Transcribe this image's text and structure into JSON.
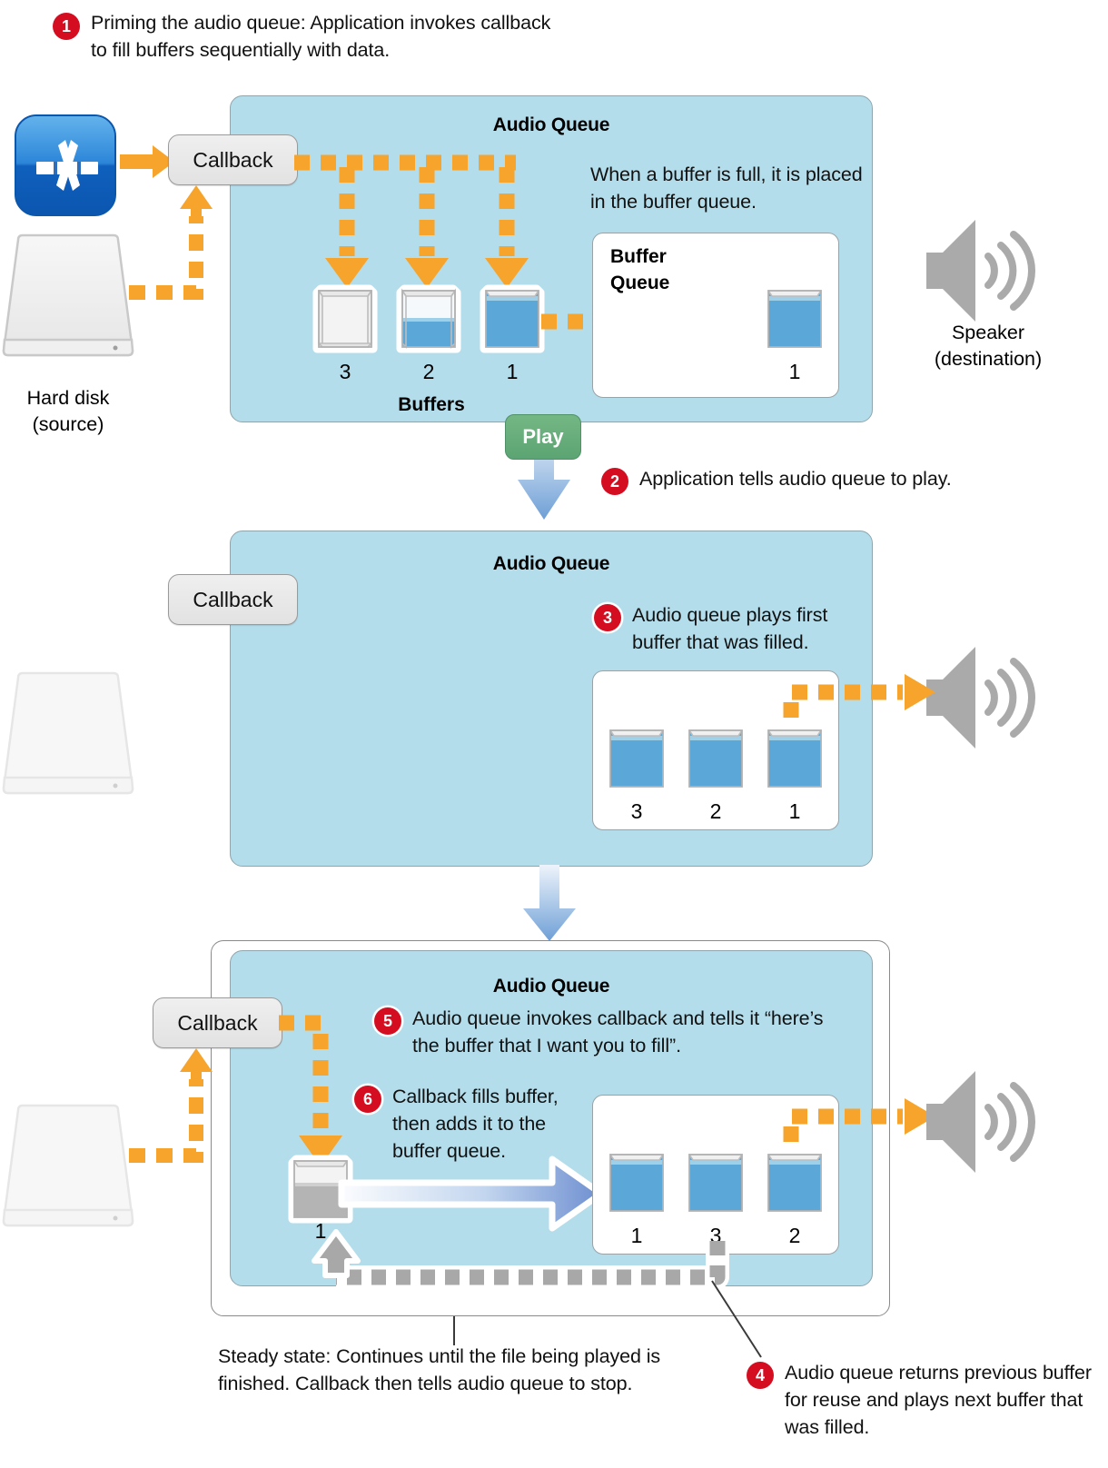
{
  "colors": {
    "panel_fill": "#b4ddeb",
    "panel_border": "#8fa6ae",
    "badge_red": "#d50d20",
    "dash_orange": "#f6a42c",
    "dash_grey": "#a8a8a8",
    "buffer_blue": "#5ba8d8",
    "play_green": "#5ca473",
    "arrow_blue": "#6e9fd6",
    "speaker_grey": "#aaaaaa"
  },
  "steps": [
    {
      "num": "1",
      "text": "Priming the audio queue: Application invokes callback to fill buffers sequentially with data."
    },
    {
      "num": "2",
      "text": "Application tells audio queue to play."
    },
    {
      "num": "3",
      "text": "Audio queue plays first buffer that was filled."
    },
    {
      "num": "4",
      "text": "Audio queue returns previous buffer for reuse and plays next buffer that was filled."
    },
    {
      "num": "5",
      "text": "Audio queue invokes callback and tells it “here’s the buffer that I want you to fill”."
    },
    {
      "num": "6",
      "text": "Callback fills buffer, then adds it to the buffer queue."
    }
  ],
  "labels": {
    "hard_disk": "Hard disk\n(source)",
    "hard_disk_line1": "Hard disk",
    "hard_disk_line2": "(source)",
    "speaker_line1": "Speaker",
    "speaker_line2": "(destination)",
    "callback": "Callback",
    "play": "Play",
    "audio_queue": "Audio Queue",
    "buffers": "Buffers",
    "buffer_queue_line1": "Buffer",
    "buffer_queue_line2": "Queue",
    "buffer_full_note": "When a buffer is full, it is placed in the buffer queue.",
    "steady_state": "Steady state: Continues until the file being played is finished. Callback then tells audio queue to stop."
  },
  "panel1": {
    "title": "Audio Queue",
    "callback": "Callback",
    "note": "When a buffer is full, it is placed in the buffer queue.",
    "buffers_label": "Buffers",
    "buffers": [
      {
        "id": "3",
        "fill": "empty"
      },
      {
        "id": "2",
        "fill": "half"
      },
      {
        "id": "1",
        "fill": "full"
      }
    ],
    "buffer_queue": {
      "title_line1": "Buffer",
      "title_line2": "Queue",
      "items": [
        {
          "id": "1",
          "fill": "full"
        }
      ]
    }
  },
  "panel2": {
    "title": "Audio Queue",
    "callback": "Callback",
    "buffer_queue": {
      "items": [
        {
          "id": "3",
          "fill": "full"
        },
        {
          "id": "2",
          "fill": "full"
        },
        {
          "id": "1",
          "fill": "full"
        }
      ]
    }
  },
  "panel3": {
    "title": "Audio Queue",
    "callback": "Callback",
    "recycled_buffer": {
      "id": "1",
      "fill": "grey"
    },
    "buffer_queue": {
      "items": [
        {
          "id": "1",
          "fill": "full"
        },
        {
          "id": "3",
          "fill": "full"
        },
        {
          "id": "2",
          "fill": "full"
        }
      ]
    }
  }
}
